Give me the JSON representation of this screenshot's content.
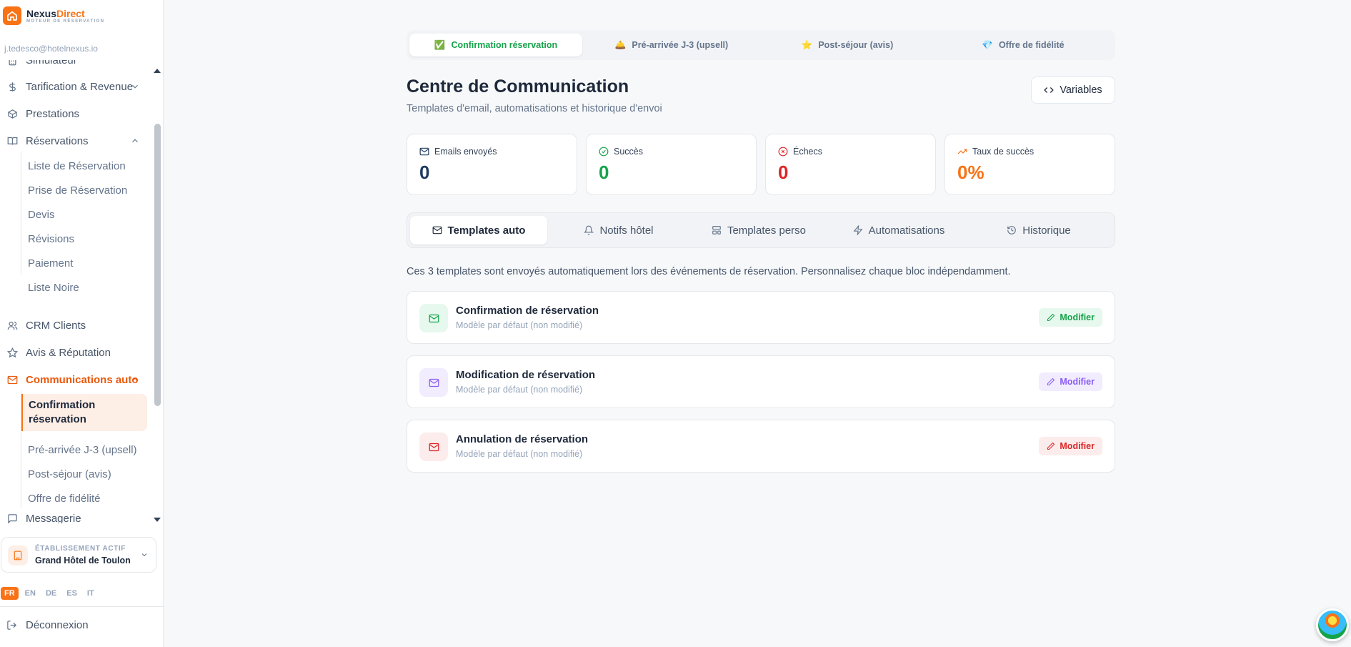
{
  "brand": {
    "name_part1": "Nexus",
    "name_part2": "Direct",
    "tagline": "MOTEUR DE RÉSERVATION"
  },
  "user": {
    "email": "j.tedesco@hotelnexus.io"
  },
  "sidebar": {
    "items": [
      {
        "label": "Simulateur",
        "icon": "calculator-icon"
      },
      {
        "label": "Tarification & Revenue",
        "icon": "dollar-icon"
      },
      {
        "label": "Prestations",
        "icon": "package-icon"
      },
      {
        "label": "Réservations",
        "icon": "book-icon"
      },
      {
        "label": "CRM Clients",
        "icon": "users-icon"
      },
      {
        "label": "Avis & Réputation",
        "icon": "star-icon"
      },
      {
        "label": "Communications auto",
        "icon": "mail-icon"
      },
      {
        "label": "Messagerie",
        "icon": "message-icon"
      }
    ],
    "reservations_sub": [
      "Liste de Réservation",
      "Prise de Réservation",
      "Devis",
      "Révisions",
      "Paiement",
      "Liste Noire"
    ],
    "communications_sub": [
      "Confirmation réservation",
      "Pré-arrivée J-3 (upsell)",
      "Post-séjour (avis)",
      "Offre de fidélité"
    ],
    "establishment": {
      "label": "ÉTABLISSEMENT ACTIF",
      "name": "Grand Hôtel de Toulon"
    },
    "languages": [
      "FR",
      "EN",
      "DE",
      "ES",
      "IT"
    ],
    "active_language": "FR",
    "logout": "Déconnexion"
  },
  "top_tabs": [
    {
      "label": "Confirmation réservation",
      "emoji": "✅"
    },
    {
      "label": "Pré-arrivée J-3 (upsell)",
      "emoji": "🛎️"
    },
    {
      "label": "Post-séjour (avis)",
      "emoji": "⭐"
    },
    {
      "label": "Offre de fidélité",
      "emoji": "💎"
    }
  ],
  "header": {
    "title": "Centre de Communication",
    "subtitle": "Templates d'email, automatisations et historique d'envoi",
    "variables_label": "Variables"
  },
  "stats": [
    {
      "label": "Emails envoyés",
      "value": "0",
      "color": "#1e3a5f"
    },
    {
      "label": "Succès",
      "value": "0",
      "color": "#16a34a"
    },
    {
      "label": "Échecs",
      "value": "0",
      "color": "#dc2626"
    },
    {
      "label": "Taux de succès",
      "value": "0%",
      "color": "#f97316"
    }
  ],
  "section_tabs": [
    {
      "label": "Templates auto"
    },
    {
      "label": "Notifs hôtel"
    },
    {
      "label": "Templates perso"
    },
    {
      "label": "Automatisations"
    },
    {
      "label": "Historique"
    }
  ],
  "intro": "Ces 3 templates sont envoyés automatiquement lors des événements de réservation. Personnalisez chaque bloc indépendamment.",
  "templates": [
    {
      "title": "Confirmation de réservation",
      "subtitle": "Modèle par défaut (non modifié)",
      "button": "Modifier",
      "color": "#16a34a",
      "bg": "#e7f8ee"
    },
    {
      "title": "Modification de réservation",
      "subtitle": "Modèle par défaut (non modifié)",
      "button": "Modifier",
      "color": "#8b5cf6",
      "bg": "#f1ecfe"
    },
    {
      "title": "Annulation de réservation",
      "subtitle": "Modèle par défaut (non modifié)",
      "button": "Modifier",
      "color": "#dc2626",
      "bg": "#fdecec"
    }
  ],
  "colors": {
    "accent": "#f97316",
    "success": "#16a34a"
  }
}
